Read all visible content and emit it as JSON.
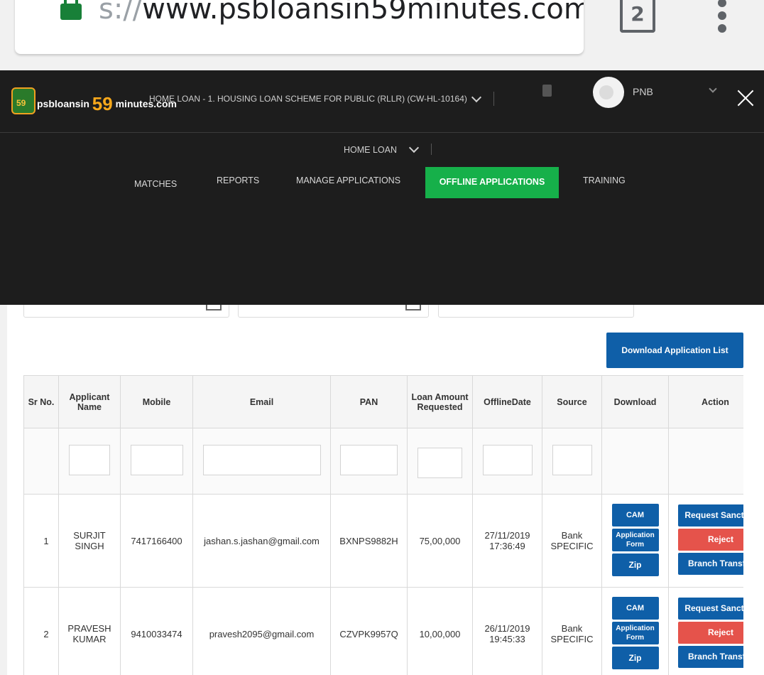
{
  "browser": {
    "url_scheme_fragment": "s://",
    "url_host": "www.psbloansin59minutes.com",
    "tab_count": "2"
  },
  "header": {
    "logo_text": "psbloansin",
    "logo_number": "59",
    "logo_suffix": "minutes.com",
    "logo_badge": "59",
    "scheme_selected": "HOME LOAN - 1. HOUSING LOAN SCHEME FOR PUBLIC (RLLR) (CW-HL-10164)",
    "bank": "PNB"
  },
  "subheader": {
    "loan_type": "HOME LOAN"
  },
  "nav": {
    "items": [
      {
        "label": "MATCHES"
      },
      {
        "label": "REPORTS"
      },
      {
        "label": "MANAGE APPLICATIONS"
      },
      {
        "label": "OFFLINE APPLICATIONS",
        "active": true
      },
      {
        "label": "TRAINING"
      }
    ]
  },
  "toolbar": {
    "download_label": "Download Application List"
  },
  "table": {
    "columns": [
      "Sr No.",
      "Applicant Name",
      "Mobile",
      "Email",
      "PAN",
      "Loan Amount Requested",
      "OfflineDate",
      "Source",
      "Download",
      "Action"
    ],
    "rows": [
      {
        "sr": "1",
        "name": "SURJIT SINGH",
        "mobile": "7417166400",
        "email": "jashan.s.jashan@gmail.com",
        "pan": "BXNPS9882H",
        "amount": "75,00,000",
        "date": "27/11/2019 17:36:49",
        "source": "Bank SPECIFIC"
      },
      {
        "sr": "2",
        "name": "PRAVESH KUMAR",
        "mobile": "9410033474",
        "email": "pravesh2095@gmail.com",
        "pan": "CZVPK9957Q",
        "amount": "10,00,000",
        "date": "26/11/2019 19:45:33",
        "source": "Bank SPECIFIC"
      }
    ],
    "download_buttons": {
      "cam": "CAM",
      "app_form": "Application Form",
      "zip": "Zip"
    },
    "action_buttons": {
      "sanction": "Request Sanction",
      "reject": "Reject",
      "transfer": "Branch Transfer"
    }
  },
  "colors": {
    "overlay_bg": "#1d1d1d",
    "active_nav": "#16b04a",
    "primary_button": "#0f5fa8",
    "reject_button": "#e5534b",
    "lock_green": "#188038"
  }
}
